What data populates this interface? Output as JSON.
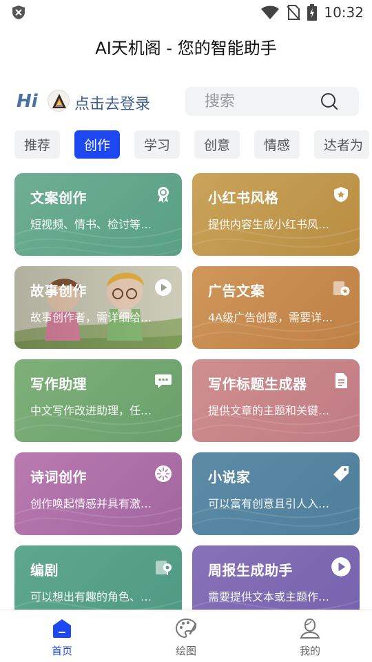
{
  "status_bar": {
    "time": "10:32"
  },
  "app": {
    "title": "AI天机阁 - 您的智能助手"
  },
  "header": {
    "hi": "Hi",
    "login_text": "点击去登录",
    "search_placeholder": "搜索"
  },
  "tabs": [
    {
      "label": "推荐",
      "active": false
    },
    {
      "label": "创作",
      "active": true
    },
    {
      "label": "学习",
      "active": false
    },
    {
      "label": "创意",
      "active": false
    },
    {
      "label": "情感",
      "active": false
    },
    {
      "label": "达者为",
      "active": false
    }
  ],
  "cards": [
    {
      "title": "文案创作",
      "desc": "短视频、情书、检讨等…",
      "icon": "badge-icon",
      "color": "#62a68b"
    },
    {
      "title": "小红书风格",
      "desc": "提供内容生成小红书风…",
      "icon": "shield-star-icon",
      "color": "#c1984e"
    },
    {
      "title": "故事创作",
      "desc": "故事创作者，需详细给…",
      "icon": "play-icon",
      "color": "#9fb38a"
    },
    {
      "title": "广告文案",
      "desc": "4A级广告创意，需要详…",
      "icon": "ad-card-icon",
      "color": "#c78b4f"
    },
    {
      "title": "写作助理",
      "desc": "中文写作改进助理，任…",
      "icon": "chat-icon",
      "color": "#74a872"
    },
    {
      "title": "写作标题生成器",
      "desc": "提供文章的主题和关键…",
      "icon": "document-icon",
      "color": "#c88589"
    },
    {
      "title": "诗词创作",
      "desc": "创作唤起情感并具有激…",
      "icon": "compass-icon",
      "color": "#ae70a8"
    },
    {
      "title": "小说家",
      "desc": "可以富有创意且引人入…",
      "icon": "tag-icon",
      "color": "#5585a0"
    },
    {
      "title": "编剧",
      "desc": "可以想出有趣的角色、…",
      "icon": "script-icon",
      "color": "#57a089"
    },
    {
      "title": "周报生成助手",
      "desc": "需要提供文本或主题作…",
      "icon": "play-icon",
      "color": "#7e6ab3"
    }
  ],
  "bottom_nav": [
    {
      "label": "首页",
      "icon": "home-icon",
      "active": true
    },
    {
      "label": "绘图",
      "icon": "palette-icon",
      "active": false
    },
    {
      "label": "我的",
      "icon": "user-icon",
      "active": false
    }
  ],
  "colors": {
    "accent": "#1d47f0",
    "login_text": "#3f5f8f"
  }
}
